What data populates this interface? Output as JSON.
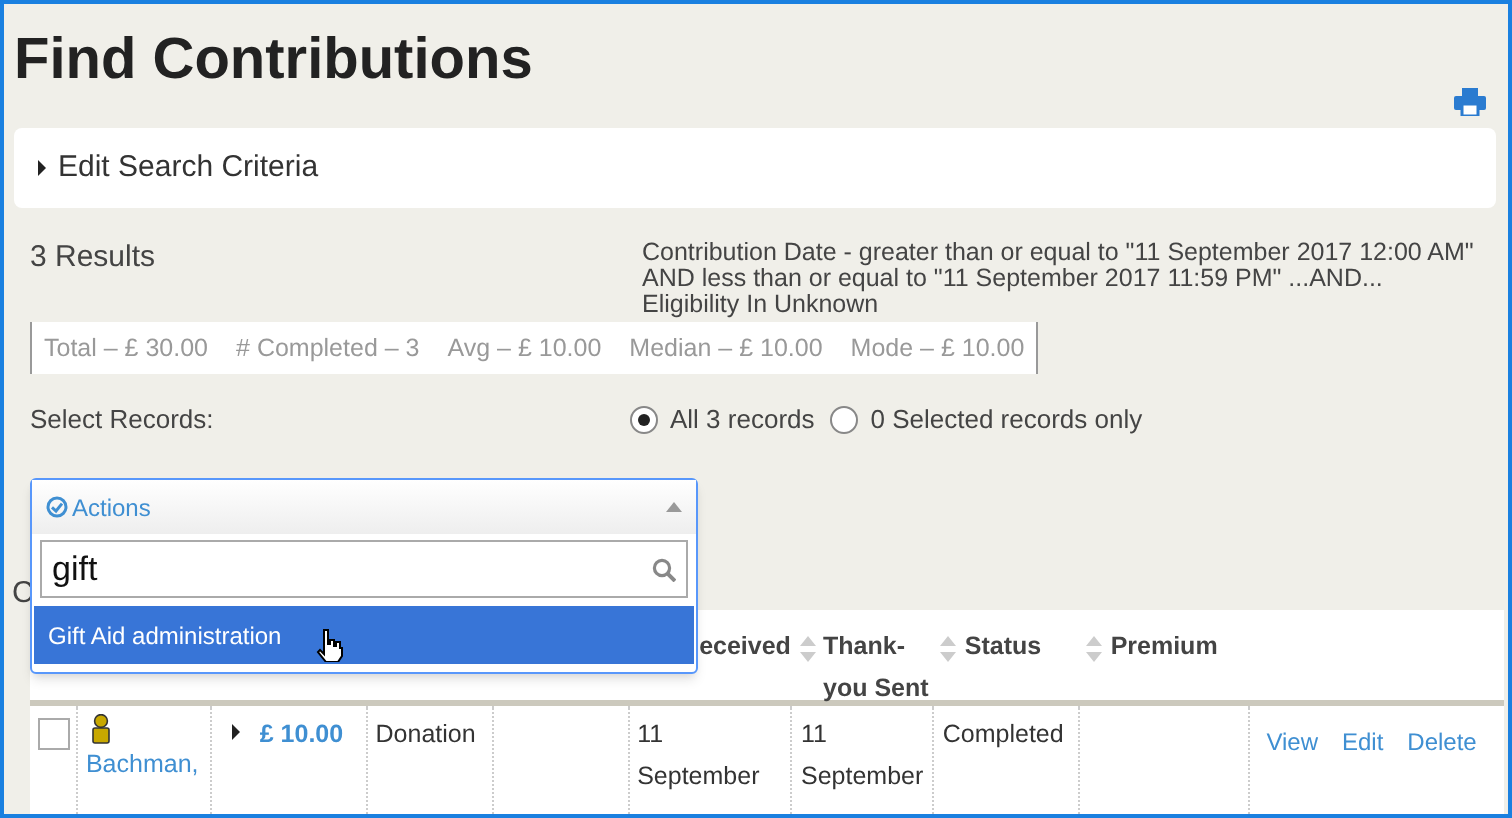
{
  "page_title": "Find Contributions",
  "search_panel": {
    "label": "Edit Search Criteria",
    "expanded": false
  },
  "results": {
    "count": "3 Results",
    "criteria": "Contribution Date - greater than or equal to \"11 September 2017 12:00 AM\" AND less than or equal to \"11 September 2017 11:59 PM\" ...AND... Eligibility In Unknown",
    "stats": [
      "Total – £ 30.00",
      "# Completed – 3",
      "Avg – £ 10.00",
      "Median – £ 10.00",
      "Mode – £ 10.00"
    ]
  },
  "select_records": {
    "label": "Select Records:",
    "options": [
      {
        "label": "All 3 records",
        "selected": true
      },
      {
        "label": "0 Selected records only",
        "selected": false
      }
    ]
  },
  "actions_dropdown": {
    "label": "Actions",
    "search_value": "gift",
    "results": [
      {
        "label": "Gift Aid administration",
        "selected": true
      }
    ]
  },
  "hidden_heading": "C",
  "table": {
    "columns": [
      {},
      {},
      {},
      {},
      {},
      {
        "label": "eceived",
        "sortable": false
      },
      {
        "label": "Thank-you Sent",
        "sortable": true
      },
      {
        "label": "Status",
        "sortable": true
      },
      {
        "label": "Premium",
        "sortable": true
      },
      {
        "sortable": false
      }
    ],
    "rows": [
      {
        "checked": false,
        "contact": "Bachman,",
        "amount": "£ 10.00",
        "type": "Donation",
        "received": "11 September",
        "thankyou": "11 September",
        "status": "Completed",
        "links": [
          "View",
          "Edit",
          "Delete"
        ]
      }
    ]
  }
}
